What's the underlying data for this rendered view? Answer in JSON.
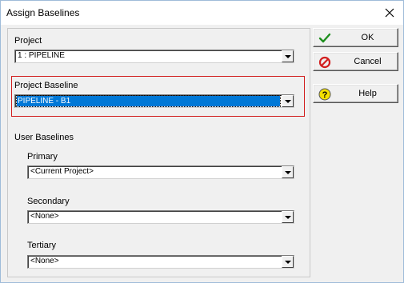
{
  "window": {
    "title": "Assign Baselines"
  },
  "project": {
    "label": "Project",
    "value": "1 : PIPELINE"
  },
  "project_baseline": {
    "label": "Project Baseline",
    "value": "PIPELINE - B1"
  },
  "user_baselines": {
    "label": "User Baselines",
    "primary": {
      "label": "Primary",
      "value": "<Current Project>"
    },
    "secondary": {
      "label": "Secondary",
      "value": "<None>"
    },
    "tertiary": {
      "label": "Tertiary",
      "value": "<None>"
    }
  },
  "buttons": {
    "ok": {
      "label": "OK",
      "icon": "checkmark-icon",
      "color": "#1e8f1e"
    },
    "cancel": {
      "label": "Cancel",
      "icon": "cancel-icon",
      "color": "#d21e1e"
    },
    "help": {
      "label": "Help",
      "icon": "help-icon",
      "color": "#e8d400"
    }
  },
  "colors": {
    "selection": "#0078d7",
    "highlight_border": "#d21e1e"
  }
}
